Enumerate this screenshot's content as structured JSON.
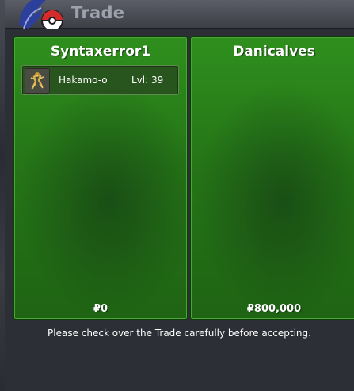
{
  "window": {
    "title": "Trade"
  },
  "trade": {
    "left": {
      "player_name": "Syntaxerror1",
      "items": [
        {
          "name": "Hakamo-o",
          "level": "Lvl: 39",
          "icon": "hakamo-o-sprite-icon"
        }
      ],
      "money": "₽0"
    },
    "right": {
      "player_name": "Danicalves",
      "items": [],
      "money": "₽800,000"
    }
  },
  "footer": {
    "message": "Please check over the Trade carefully before accepting."
  },
  "colors": {
    "panel_green": "#257517",
    "panel_border": "#4aa638",
    "background": "#2d2f36"
  }
}
